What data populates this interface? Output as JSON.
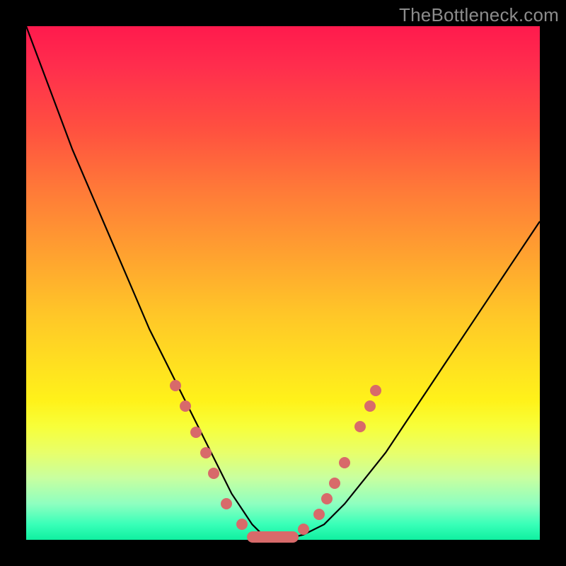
{
  "watermark": "TheBottleneck.com",
  "colors": {
    "background": "#000000",
    "curve": "#000000",
    "dots": "#d86a6a",
    "gradient_top": "#ff1a4d",
    "gradient_bottom": "#10f0a0"
  },
  "chart_data": {
    "type": "line",
    "title": "",
    "xlabel": "",
    "ylabel": "",
    "xlim": [
      0,
      100
    ],
    "ylim": [
      0,
      100
    ],
    "grid": false,
    "legend": false,
    "annotations": [
      "TheBottleneck.com"
    ],
    "series": [
      {
        "name": "bottleneck-curve",
        "x": [
          0,
          3,
          6,
          9,
          12,
          15,
          18,
          21,
          24,
          27,
          30,
          33,
          36,
          38,
          40,
          42,
          44,
          46,
          50,
          54,
          58,
          62,
          66,
          70,
          74,
          78,
          82,
          86,
          90,
          94,
          100
        ],
        "y": [
          100,
          92,
          84,
          76,
          69,
          62,
          55,
          48,
          41,
          35,
          29,
          23,
          17,
          13,
          9,
          6,
          3,
          1,
          0,
          1,
          3,
          7,
          12,
          17,
          23,
          29,
          35,
          41,
          47,
          53,
          62
        ]
      }
    ],
    "highlighted_points": {
      "left_branch": [
        {
          "x": 29,
          "y": 30
        },
        {
          "x": 31,
          "y": 26
        },
        {
          "x": 33,
          "y": 21
        },
        {
          "x": 35,
          "y": 17
        },
        {
          "x": 36.5,
          "y": 13
        },
        {
          "x": 39,
          "y": 7
        },
        {
          "x": 42,
          "y": 3
        }
      ],
      "bottom_segment": {
        "x_start": 43,
        "x_end": 53,
        "y": 0.5
      },
      "right_branch": [
        {
          "x": 54,
          "y": 2
        },
        {
          "x": 57,
          "y": 5
        },
        {
          "x": 58.5,
          "y": 8
        },
        {
          "x": 60,
          "y": 11
        },
        {
          "x": 62,
          "y": 15
        },
        {
          "x": 65,
          "y": 22
        },
        {
          "x": 67,
          "y": 26
        },
        {
          "x": 68,
          "y": 29
        }
      ]
    }
  }
}
